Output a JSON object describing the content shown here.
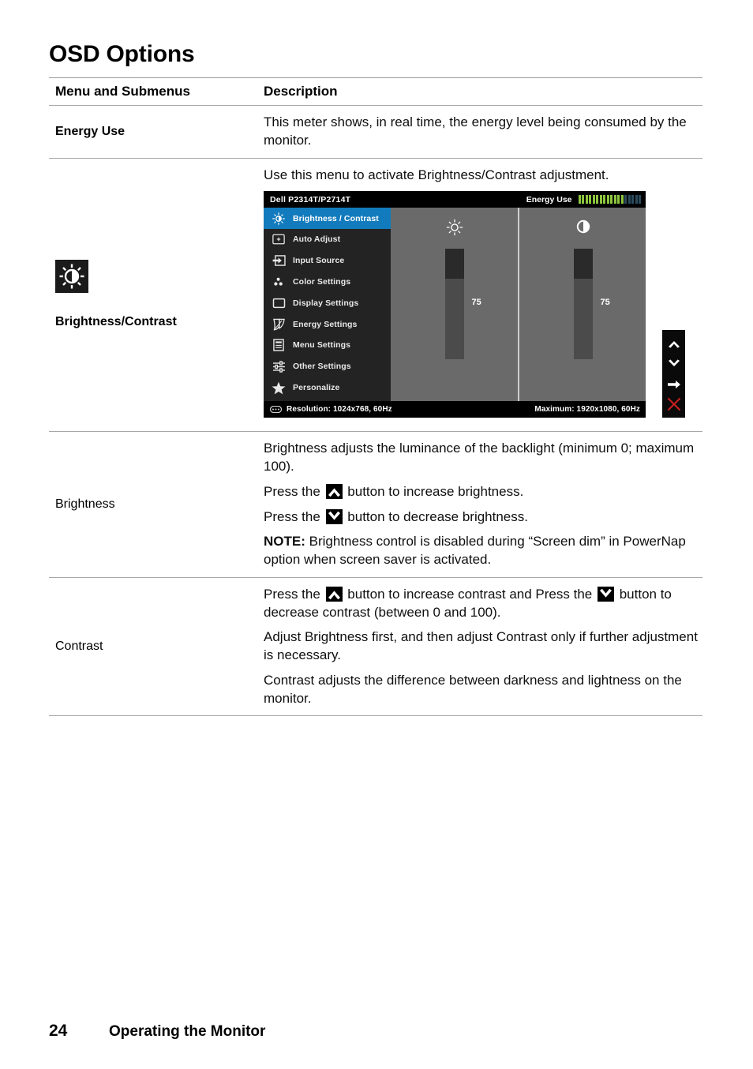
{
  "page": {
    "title": "OSD Options",
    "footer_page_number": "24",
    "footer_text": "Operating the Monitor"
  },
  "table": {
    "headers": {
      "col1": "Menu and Submenus",
      "col2": "Description"
    },
    "rows": [
      {
        "label": "Energy Use",
        "label_style": "bold",
        "paragraphs": [
          "This meter shows, in real time, the energy level being consumed by the monitor."
        ]
      },
      {
        "label": "Brightness/Contrast",
        "label_style": "bold",
        "icon": "brightness-contrast-icon",
        "paragraphs": [
          "Use this menu to activate Brightness/Contrast adjustment."
        ]
      },
      {
        "label": "Brightness",
        "label_style": "regular",
        "paragraphs": [
          "Brightness adjusts the luminance of the backlight (minimum 0; maximum 100).",
          "Press the  button to increase brightness.",
          "Press the  button to decrease brightness.",
          "NOTE: Brightness control is disabled during “Screen dim” in PowerNap option when screen saver is activated."
        ]
      },
      {
        "label": "Contrast",
        "label_style": "regular",
        "paragraphs": [
          "Press the  button to increase contrast and Press the  button to decrease contrast (between 0 and 100).",
          "Adjust Brightness first, and then adjust Contrast only if further adjustment is necessary.",
          "Contrast adjusts the difference between darkness and lightness on the monitor."
        ]
      }
    ]
  },
  "brightness_row": {
    "line1": "Brightness adjusts the luminance of the backlight (minimum 0; maximum 100).",
    "line2_pre": "Press the",
    "line2_post": "button to increase brightness.",
    "line3_pre": "Press the",
    "line3_post": "button to decrease brightness.",
    "note_label": "NOTE:",
    "note_text": "Brightness control is disabled during “Screen dim” in PowerNap option when screen saver is activated."
  },
  "contrast_row": {
    "line1_pre": "Press the",
    "line1_mid": "button to increase contrast and Press the",
    "line1_post": "button to decrease contrast (between 0 and 100).",
    "line2": "Adjust Brightness first, and then adjust Contrast only if further adjustment is necessary.",
    "line3": "Contrast adjusts the difference between darkness and lightness on the monitor."
  },
  "osd": {
    "model": "Dell P2314T/P2714T",
    "energy_label": "Energy Use",
    "energy_meter": {
      "total_segments": 18,
      "lit_segments": 13,
      "lit_color": "#8dc63f",
      "unlit_color": "#2b4c5e"
    },
    "menu_items": [
      {
        "label": "Brightness / Contrast",
        "icon": "brightness-contrast-icon",
        "selected": true
      },
      {
        "label": "Auto Adjust",
        "icon": "auto-adjust-icon",
        "selected": false
      },
      {
        "label": "Input Source",
        "icon": "input-source-icon",
        "selected": false
      },
      {
        "label": "Color Settings",
        "icon": "color-settings-icon",
        "selected": false
      },
      {
        "label": "Display Settings",
        "icon": "display-settings-icon",
        "selected": false
      },
      {
        "label": "Energy Settings",
        "icon": "energy-leaf-icon",
        "selected": false
      },
      {
        "label": "Menu Settings",
        "icon": "menu-settings-icon",
        "selected": false
      },
      {
        "label": "Other Settings",
        "icon": "sliders-icon",
        "selected": false
      },
      {
        "label": "Personalize",
        "icon": "star-icon",
        "selected": false
      }
    ],
    "sliders": [
      {
        "name": "brightness",
        "icon": "sun-icon",
        "value": "75",
        "fill_percent": 73
      },
      {
        "name": "contrast",
        "icon": "contrast-circle-icon",
        "value": "75",
        "fill_percent": 73
      }
    ],
    "status": {
      "resolution": "Resolution:  1024x768, 60Hz",
      "maximum": "Maximum: 1920x1080, 60Hz"
    },
    "buttons": [
      {
        "name": "up-arrow-button",
        "glyph": "chevron-up"
      },
      {
        "name": "down-arrow-button",
        "glyph": "chevron-down"
      },
      {
        "name": "right-arrow-button",
        "glyph": "arrow-right"
      },
      {
        "name": "close-button",
        "glyph": "x-mark",
        "color": "#d01f1f"
      }
    ],
    "accent_color": "#127bbd"
  }
}
